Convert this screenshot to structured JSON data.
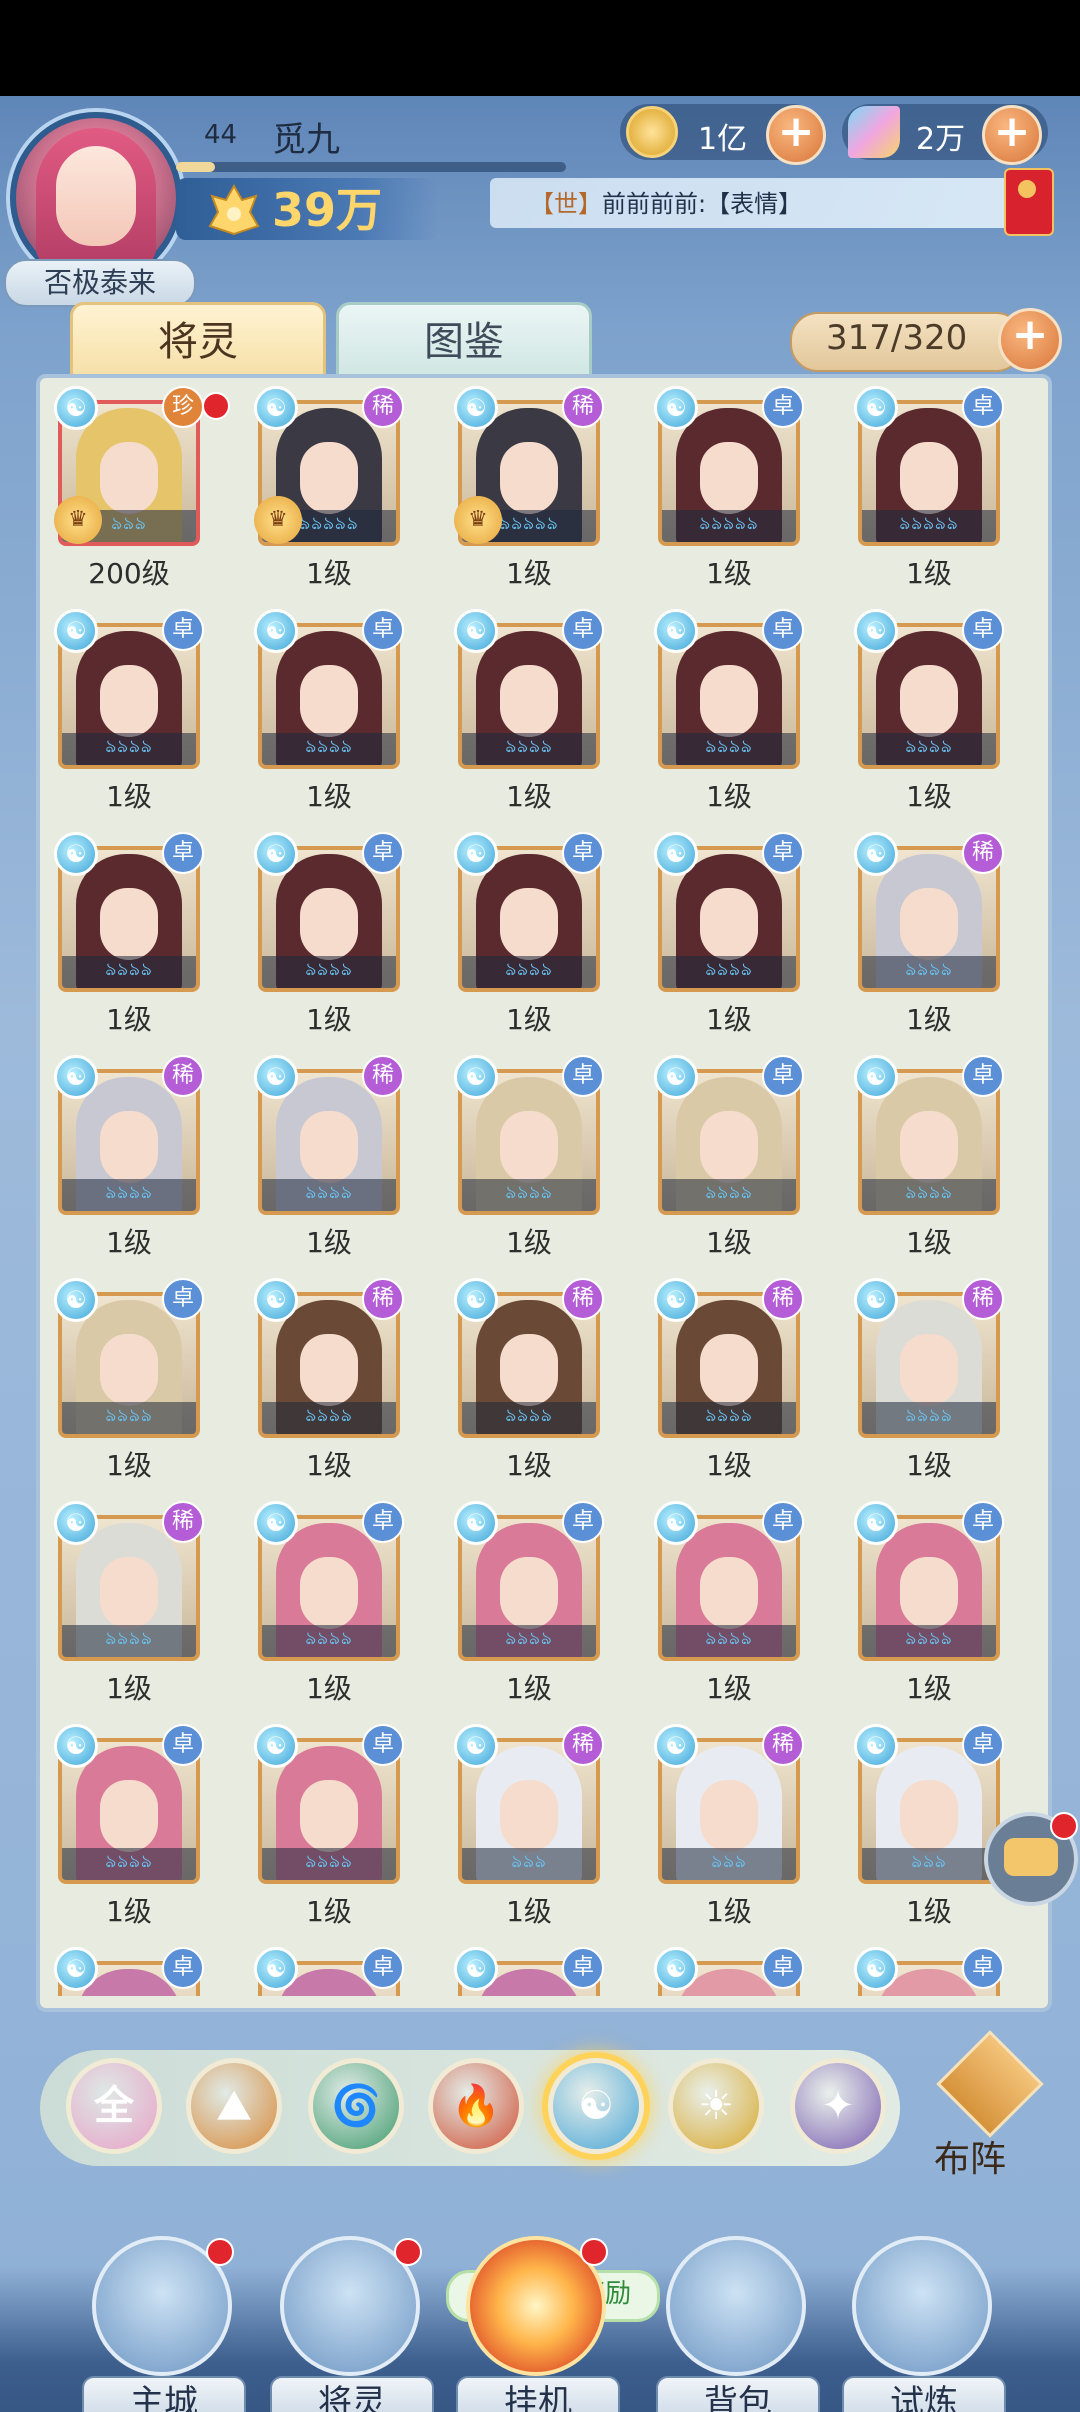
{
  "player": {
    "level": "44",
    "name": "觅九",
    "title": "否极泰来",
    "power": "39万",
    "xp_fraction": 0.1
  },
  "currency": {
    "gold": "1亿",
    "gems": "2万"
  },
  "chat": {
    "channel": "【世】",
    "message": "前前前前:【表情】"
  },
  "tabs": {
    "spirits": "将灵",
    "codex": "图鉴"
  },
  "inventory_count": "317/320",
  "element_icon_glyph": "☯",
  "rarity_labels": {
    "zhen": "珍",
    "xi": "稀",
    "zhuo": "卓"
  },
  "cards": [
    {
      "rarity": "珍",
      "level": "200级",
      "hair": "#e6c46a",
      "stars": "ঌঌঌ",
      "badge": true,
      "dot": true,
      "zhen": true
    },
    {
      "rarity": "稀",
      "level": "1级",
      "hair": "#3b3a44",
      "stars": "ঌঌঌঌঌ",
      "badge": true
    },
    {
      "rarity": "稀",
      "level": "1级",
      "hair": "#3b3a44",
      "stars": "ঌঌঌঌঌ",
      "badge": true
    },
    {
      "rarity": "卓",
      "level": "1级",
      "hair": "#5a2a2f",
      "stars": "ঌঌঌঌঌ"
    },
    {
      "rarity": "卓",
      "level": "1级",
      "hair": "#5a2a2f",
      "stars": "ঌঌঌঌঌ"
    },
    {
      "rarity": "卓",
      "level": "1级",
      "hair": "#5a2a2f",
      "stars": "ঌঌঌঌ"
    },
    {
      "rarity": "卓",
      "level": "1级",
      "hair": "#5a2a2f",
      "stars": "ঌঌঌঌ"
    },
    {
      "rarity": "卓",
      "level": "1级",
      "hair": "#5a2a2f",
      "stars": "ঌঌঌঌ"
    },
    {
      "rarity": "卓",
      "level": "1级",
      "hair": "#5a2a2f",
      "stars": "ঌঌঌঌ"
    },
    {
      "rarity": "卓",
      "level": "1级",
      "hair": "#5a2a2f",
      "stars": "ঌঌঌঌ"
    },
    {
      "rarity": "卓",
      "level": "1级",
      "hair": "#5a2a2f",
      "stars": "ঌঌঌঌ"
    },
    {
      "rarity": "卓",
      "level": "1级",
      "hair": "#5a2a2f",
      "stars": "ঌঌঌঌ"
    },
    {
      "rarity": "卓",
      "level": "1级",
      "hair": "#5a2a2f",
      "stars": "ঌঌঌঌ"
    },
    {
      "rarity": "卓",
      "level": "1级",
      "hair": "#5a2a2f",
      "stars": "ঌঌঌঌ"
    },
    {
      "rarity": "稀",
      "level": "1级",
      "hair": "#c8c8d2",
      "stars": "ঌঌঌঌ"
    },
    {
      "rarity": "稀",
      "level": "1级",
      "hair": "#c8c8d2",
      "stars": "ঌঌঌঌ"
    },
    {
      "rarity": "稀",
      "level": "1级",
      "hair": "#c8c8d2",
      "stars": "ঌঌঌঌ"
    },
    {
      "rarity": "卓",
      "level": "1级",
      "hair": "#d9c9a6",
      "stars": "ঌঌঌঌ"
    },
    {
      "rarity": "卓",
      "level": "1级",
      "hair": "#d9c9a6",
      "stars": "ঌঌঌঌ"
    },
    {
      "rarity": "卓",
      "level": "1级",
      "hair": "#d9c9a6",
      "stars": "ঌঌঌঌ"
    },
    {
      "rarity": "卓",
      "level": "1级",
      "hair": "#d9c9a6",
      "stars": "ঌঌঌঌ"
    },
    {
      "rarity": "稀",
      "level": "1级",
      "hair": "#6a4a36",
      "stars": "ঌঌঌঌ"
    },
    {
      "rarity": "稀",
      "level": "1级",
      "hair": "#6a4a36",
      "stars": "ঌঌঌঌ"
    },
    {
      "rarity": "稀",
      "level": "1级",
      "hair": "#6a4a36",
      "stars": "ঌঌঌঌ"
    },
    {
      "rarity": "稀",
      "level": "1级",
      "hair": "#dcdcd6",
      "stars": "ঌঌঌঌ"
    },
    {
      "rarity": "稀",
      "level": "1级",
      "hair": "#dcdcd6",
      "stars": "ঌঌঌঌ"
    },
    {
      "rarity": "卓",
      "level": "1级",
      "hair": "#d97a98",
      "stars": "ঌঌঌঌ"
    },
    {
      "rarity": "卓",
      "level": "1级",
      "hair": "#d97a98",
      "stars": "ঌঌঌঌ"
    },
    {
      "rarity": "卓",
      "level": "1级",
      "hair": "#d97a98",
      "stars": "ঌঌঌঌ"
    },
    {
      "rarity": "卓",
      "level": "1级",
      "hair": "#d97a98",
      "stars": "ঌঌঌঌ"
    },
    {
      "rarity": "卓",
      "level": "1级",
      "hair": "#d97a98",
      "stars": "ঌঌঌঌ"
    },
    {
      "rarity": "卓",
      "level": "1级",
      "hair": "#d97a98",
      "stars": "ঌঌঌঌ"
    },
    {
      "rarity": "稀",
      "level": "1级",
      "hair": "#e8ecf2",
      "stars": "ঌঌঌ"
    },
    {
      "rarity": "稀",
      "level": "1级",
      "hair": "#e8ecf2",
      "stars": "ঌঌঌ"
    },
    {
      "rarity": "卓",
      "level": "1级",
      "hair": "#e8ecf2",
      "stars": "ঌঌঌ"
    },
    {
      "rarity": "卓",
      "level": "",
      "hair": "#c77aa9",
      "stars": ""
    },
    {
      "rarity": "卓",
      "level": "",
      "hair": "#c77aa9",
      "stars": ""
    },
    {
      "rarity": "卓",
      "level": "",
      "hair": "#c77aa9",
      "stars": ""
    },
    {
      "rarity": "卓",
      "level": "",
      "hair": "#e29aa6",
      "stars": ""
    },
    {
      "rarity": "卓",
      "level": "",
      "hair": "#e29aa6",
      "stars": ""
    }
  ],
  "filters": [
    {
      "name": "all",
      "label": "全",
      "color": "#e8a2c8",
      "selected": false
    },
    {
      "name": "mountain",
      "label": "⛰",
      "color": "#d88a3a",
      "selected": false
    },
    {
      "name": "wind",
      "label": "🌀",
      "color": "#3e9a6c",
      "selected": false
    },
    {
      "name": "fire",
      "label": "🔥",
      "color": "#cf5136",
      "selected": false
    },
    {
      "name": "water",
      "label": "☯",
      "color": "#4aa6d6",
      "selected": true
    },
    {
      "name": "light",
      "label": "☀",
      "color": "#d8a92e",
      "selected": false
    },
    {
      "name": "dark",
      "label": "✦",
      "color": "#7a5fb0",
      "selected": false
    }
  ],
  "formation_label": "布阵",
  "idle_reward_tip": "领取挂机奖励",
  "nav": [
    {
      "key": "main_city",
      "label": "主城",
      "dot": true,
      "active": false
    },
    {
      "key": "spirits",
      "label": "将灵",
      "dot": true,
      "active": false
    },
    {
      "key": "idle",
      "label": "挂机",
      "dot": true,
      "active": true
    },
    {
      "key": "bag",
      "label": "背包",
      "dot": false,
      "active": false
    },
    {
      "key": "trial",
      "label": "试炼",
      "dot": false,
      "active": false
    }
  ]
}
